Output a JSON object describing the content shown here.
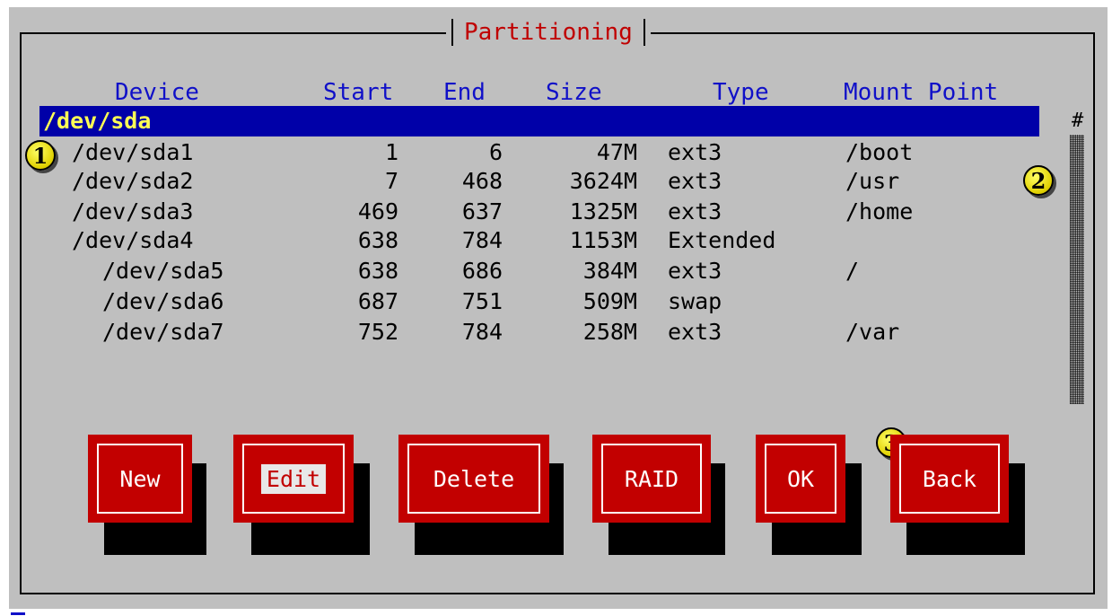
{
  "window": {
    "title": "Partitioning"
  },
  "columns": {
    "device": "Device",
    "start": "Start",
    "end": "End",
    "size": "Size",
    "type": "Type",
    "mount": "Mount Point"
  },
  "selected_disk": "/dev/sda",
  "partitions": [
    {
      "device": "/dev/sda1",
      "start": "1",
      "end": "6",
      "size": "47M",
      "type": "ext3",
      "mount": "/boot"
    },
    {
      "device": "/dev/sda2",
      "start": "7",
      "end": "468",
      "size": "3624M",
      "type": "ext3",
      "mount": "/usr"
    },
    {
      "device": "/dev/sda3",
      "start": "469",
      "end": "637",
      "size": "1325M",
      "type": "ext3",
      "mount": "/home"
    },
    {
      "device": "/dev/sda4",
      "start": "638",
      "end": "784",
      "size": "1153M",
      "type": "Extended",
      "mount": ""
    },
    {
      "device": "/dev/sda5",
      "start": "638",
      "end": "686",
      "size": "384M",
      "type": "ext3",
      "mount": "/"
    },
    {
      "device": "/dev/sda6",
      "start": "687",
      "end": "751",
      "size": "509M",
      "type": "swap",
      "mount": ""
    },
    {
      "device": "/dev/sda7",
      "start": "752",
      "end": "784",
      "size": "258M",
      "type": "ext3",
      "mount": "/var"
    }
  ],
  "scrollbar": {
    "marker": "#"
  },
  "callouts": {
    "one": "1",
    "two": "2",
    "three": "3"
  },
  "buttons": {
    "new": "New",
    "edit": "Edit",
    "delete": "Delete",
    "raid": "RAID",
    "ok": "OK",
    "back": "Back"
  },
  "colors": {
    "background": "#bfbfbf",
    "title": "#c00000",
    "header": "#1010c8",
    "selection_bg": "#0000a8",
    "selection_fg": "#ffff55",
    "button": "#c20000"
  }
}
